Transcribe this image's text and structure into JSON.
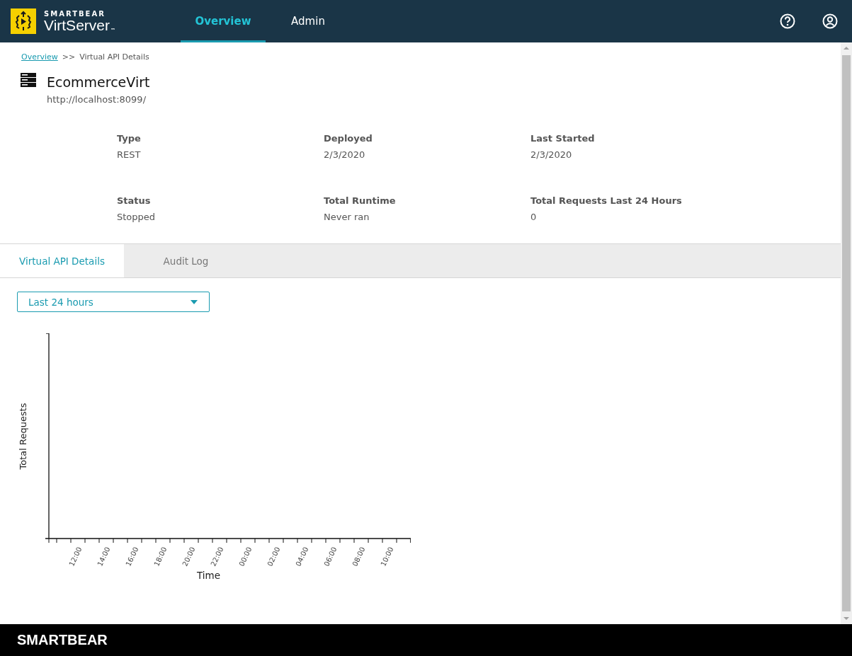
{
  "header": {
    "brand": "SMARTBEAR",
    "product": "VirtServer",
    "trademark": "™",
    "nav": [
      {
        "label": "Overview",
        "selected": true
      },
      {
        "label": "Admin",
        "selected": false
      }
    ]
  },
  "breadcrumb": {
    "link": "Overview",
    "separator": ">>",
    "current": "Virtual API Details"
  },
  "api": {
    "name": "EcommerceVirt",
    "url": "http://localhost:8099/"
  },
  "details": [
    {
      "label": "Type",
      "value": "REST"
    },
    {
      "label": "Deployed",
      "value": "2/3/2020"
    },
    {
      "label": "Last Started",
      "value": "2/3/2020"
    },
    {
      "label": "Status",
      "value": "Stopped"
    },
    {
      "label": "Total Runtime",
      "value": "Never ran"
    },
    {
      "label": "Total Requests Last 24 Hours",
      "value": "0"
    }
  ],
  "tabs": [
    {
      "label": "Virtual API Details",
      "selected": true
    },
    {
      "label": "Audit Log",
      "selected": false
    }
  ],
  "range_select": {
    "value": "Last 24 hours"
  },
  "chart": {
    "ylabel": "Total Requests",
    "xlabel": "Time",
    "xtick_labels": [
      "12:00",
      "14:00",
      "16:00",
      "18:00",
      "20:00",
      "22:00",
      "00:00",
      "02:00",
      "04:00",
      "06:00",
      "08:00",
      "10:00"
    ]
  },
  "footer": {
    "brand": "SMARTBEAR"
  }
}
